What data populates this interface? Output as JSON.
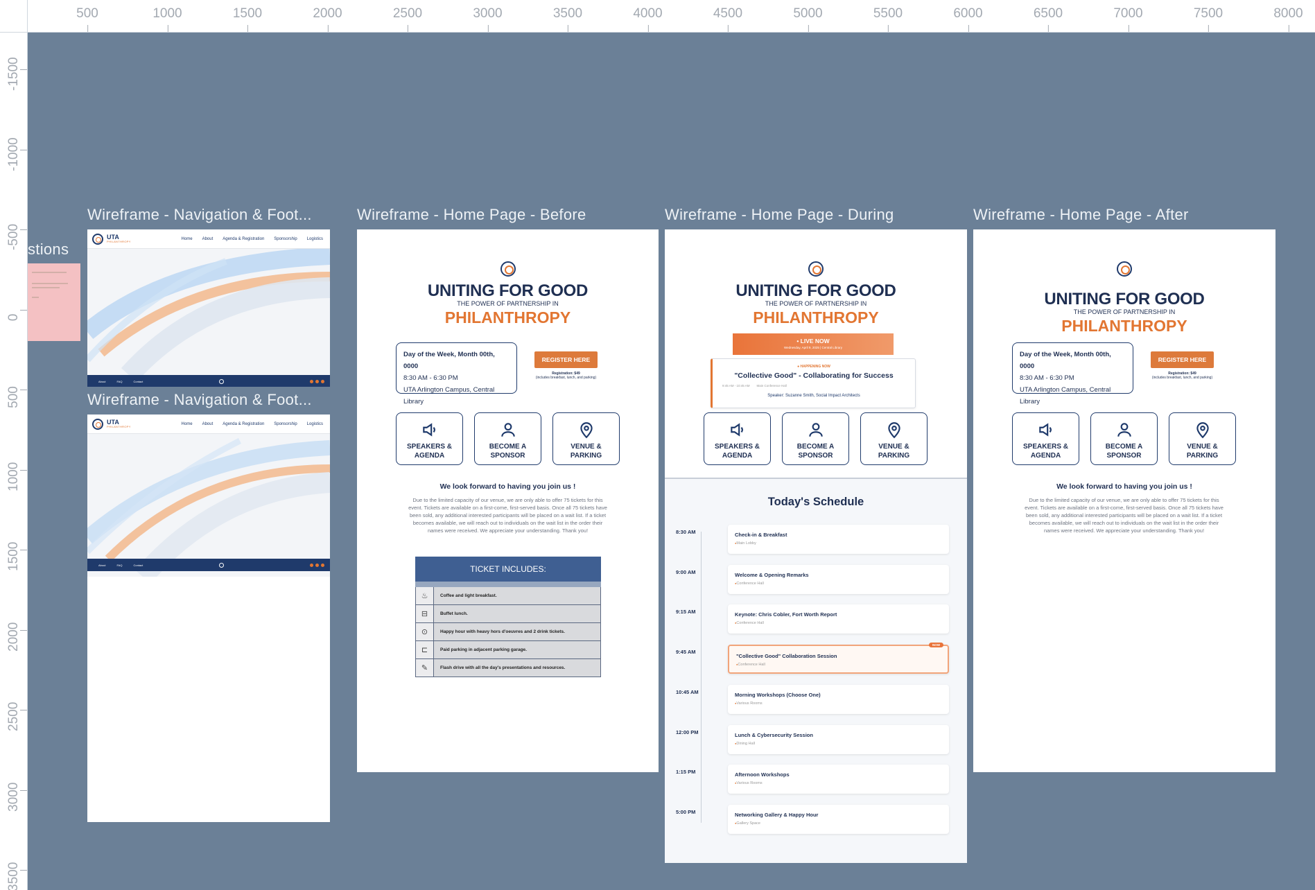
{
  "ruler": {
    "top": [
      "500",
      "1000",
      "1500",
      "2000",
      "2500",
      "3000",
      "3500",
      "4000",
      "4500",
      "5000",
      "5500",
      "6000",
      "6500",
      "7000",
      "7500",
      "8000"
    ],
    "left": [
      "-1500",
      "-1000",
      "-500",
      "0",
      "500",
      "1000",
      "1500",
      "2000",
      "2500",
      "3000",
      "3500"
    ]
  },
  "offcanvas_label": "stions",
  "frames": {
    "nav1_title": "Wireframe - Navigation & Foot...",
    "nav2_title": "Wireframe - Navigation & Foot...",
    "before_title": "Wireframe - Home Page -  Before",
    "during_title": "Wireframe - Home Page - During",
    "after_title": "Wireframe - Home Page - After"
  },
  "nav": {
    "brand": "UTA",
    "brand_sub": "PHILANTHROPY",
    "links": [
      "Home",
      "About",
      "Agenda & Registration",
      "Sponsorship",
      "Logistics"
    ],
    "footer_links": [
      "About",
      "FAQ",
      "Contact"
    ]
  },
  "home": {
    "headline": "UNITING FOR GOOD",
    "subhead": "THE POWER OF PARTNERSHIP IN",
    "accent_word": "PHILANTHROPY",
    "date_line": "Day of the Week, Month 00th, 0000",
    "time_line": "8:30 AM - 6:30 PM",
    "place_line": "UTA Arlington Campus, Central Library",
    "register_label": "REGISTER HERE",
    "reg_price": "Registration: $49",
    "reg_includes": "(includes breakfast, lunch, and parking)",
    "cards": [
      {
        "icon": "megaphone-icon",
        "label1": "SPEAKERS &",
        "label2": "AGENDA"
      },
      {
        "icon": "person-icon",
        "label1": "BECOME A",
        "label2": "SPONSOR"
      },
      {
        "icon": "location-pin-icon",
        "label1": "VENUE &",
        "label2": "PARKING"
      }
    ],
    "welcome": "We look forward to having you join us !",
    "para": "Due to the limited capacity of our venue, we are only able to offer 75 tickets for this event. Tickets are available on a first-come, first-served basis. Once all 75 tickets have been sold, any additional interested participants will be placed on a wait list. If a ticket becomes available, we will reach out to individuals on the wait list in the order their names were received. We appreciate your understanding. Thank you!"
  },
  "tickets": {
    "header": "TICKET INCLUDES:",
    "rows": [
      {
        "icon": "coffee-icon",
        "glyph": "♨",
        "text": "Coffee and light breakfast."
      },
      {
        "icon": "buffet-icon",
        "glyph": "⊟",
        "text": "Buffet lunch."
      },
      {
        "icon": "drink-icon",
        "glyph": "⊙",
        "text": "Happy hour with heavy hors d'oeuvres and 2 drink tickets."
      },
      {
        "icon": "car-icon",
        "glyph": "⊏",
        "text": "Paid parking in adjacent parking garage."
      },
      {
        "icon": "usb-icon",
        "glyph": "✎",
        "text": "Flash drive with all the day's presentations and resources."
      }
    ]
  },
  "during": {
    "live_label": "• LIVE NOW",
    "live_sub": "Wednesday, April 9, 2025 | Central Library",
    "happening_tag": "● HAPPENING NOW",
    "session_title": "\"Collective Good\" - Collaborating for Success",
    "session_time": "9:45 AM - 10:45 AM",
    "session_room": "Main Conference Hall",
    "speaker": "Speaker: Suzanne Smith, Social Impact Architects",
    "schedule_title": "Today's Schedule",
    "now_badge": "NOW",
    "schedule": [
      {
        "time": "8:30 AM",
        "title": "Check-in & Breakfast",
        "room": "Main Lobby",
        "now": false
      },
      {
        "time": "9:00 AM",
        "title": "Welcome & Opening Remarks",
        "room": "Conference Hall",
        "now": false
      },
      {
        "time": "9:15 AM",
        "title": "Keynote: Chris Cobler, Fort Worth Report",
        "room": "Conference Hall",
        "now": false
      },
      {
        "time": "9:45 AM",
        "title": "\"Collective Good\" Collaboration Session",
        "room": "Conference Hall",
        "now": true
      },
      {
        "time": "10:45 AM",
        "title": "Morning Workshops (Choose One)",
        "room": "Various Rooms",
        "now": false
      },
      {
        "time": "12:00 PM",
        "title": "Lunch & Cybersecurity Session",
        "room": "Dining Hall",
        "now": false
      },
      {
        "time": "1:15 PM",
        "title": "Afternoon Workshops",
        "room": "Various Rooms",
        "now": false
      },
      {
        "time": "5:00 PM",
        "title": "Networking Gallery & Happy Hour",
        "room": "Gallery Space",
        "now": false
      }
    ]
  }
}
